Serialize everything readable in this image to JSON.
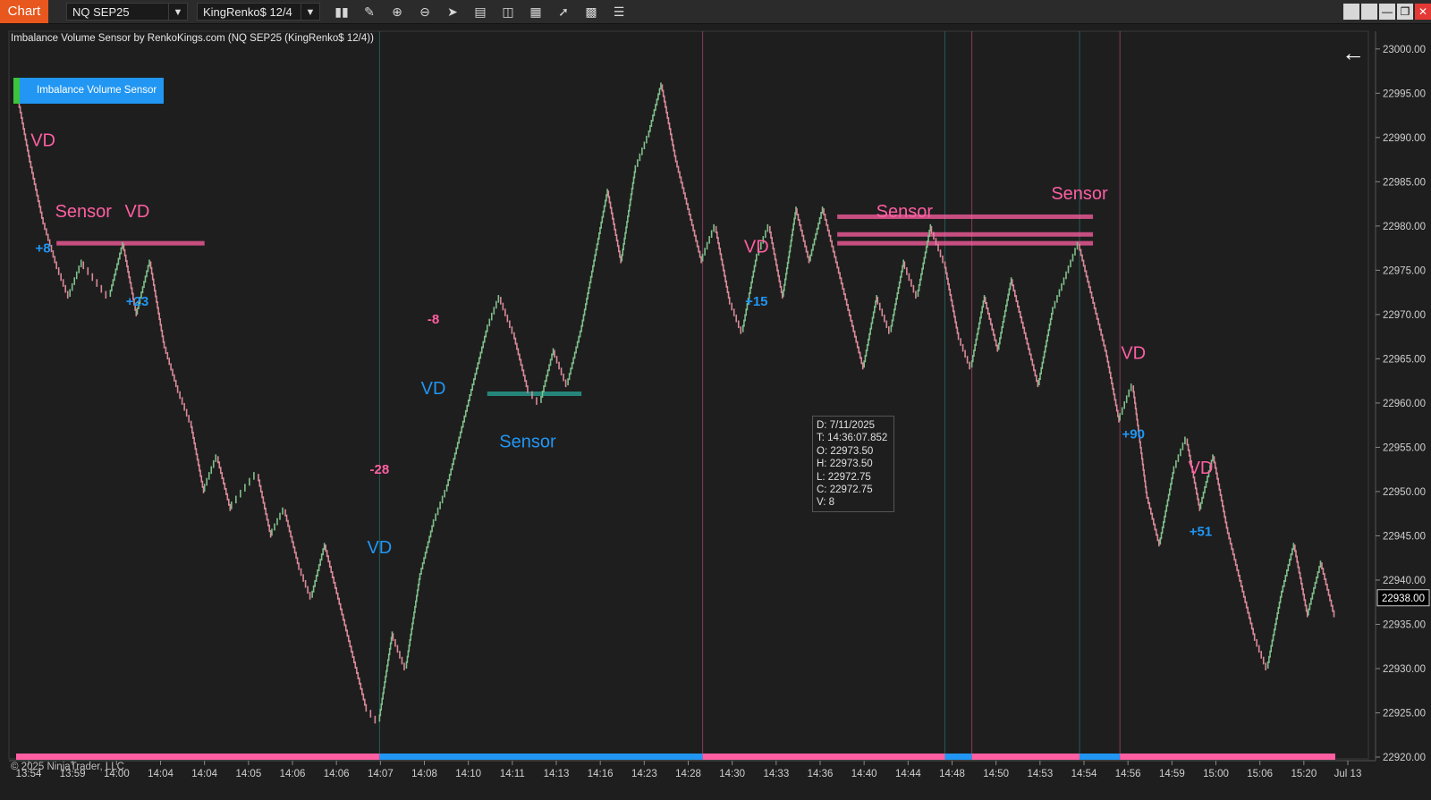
{
  "toolbar": {
    "chart_tab": "Chart",
    "instrument": "NQ SEP25",
    "bar_type": "KingRenko$ 12/4",
    "icons": [
      "bar-style-icon",
      "draw-tool-icon",
      "zoom-in-icon",
      "zoom-out-icon",
      "pointer-icon",
      "data-box-icon",
      "properties-icon",
      "indicators-icon",
      "strategies-icon",
      "chart-trader-icon",
      "object-list-icon"
    ],
    "window_buttons": [
      "tile-icon",
      "tile-icon",
      "minimize-icon",
      "maximize-icon",
      "close-icon"
    ]
  },
  "indicator_label": "Imbalance Volume Sensor by RenkoKings.com (NQ SEP25 (KingRenko$ 12/4))",
  "ivs_button": "Imbalance Volume Sensor",
  "copyright": "© 2025 NinjaTrader, LLC",
  "tooltip": {
    "d": "D: 7/11/2025",
    "t": "T:  14:36:07.852",
    "o": "O: 22973.50",
    "h": "H: 22973.50",
    "l": "L:  22972.75",
    "c": "C:  22972.75",
    "v": "V:  8"
  },
  "colors": {
    "bull": "#7fbf8a",
    "bear": "#d98a9a",
    "pink": "#ff5fa2",
    "blue": "#2196f3",
    "teal": "#2aa89a",
    "price_marker": "#000000"
  },
  "chart_data": {
    "type": "line",
    "ylim": [
      22920,
      23002
    ],
    "y_ticks": [
      "23000.00",
      "22995.00",
      "22990.00",
      "22985.00",
      "22980.00",
      "22975.00",
      "22970.00",
      "22965.00",
      "22960.00",
      "22955.00",
      "22950.00",
      "22945.00",
      "22940.00",
      "22935.00",
      "22930.00",
      "22925.00",
      "22920.00"
    ],
    "y_tick_values": [
      23000,
      22995,
      22990,
      22985,
      22980,
      22975,
      22970,
      22965,
      22960,
      22955,
      22950,
      22945,
      22940,
      22935,
      22930,
      22925,
      22920
    ],
    "x_ticks": [
      "13:54",
      "13:59",
      "14:00",
      "14:04",
      "14:04",
      "14:05",
      "14:06",
      "14:06",
      "14:07",
      "14:08",
      "14:10",
      "14:11",
      "14:13",
      "14:16",
      "14:23",
      "14:28",
      "14:30",
      "14:33",
      "14:36",
      "14:40",
      "14:44",
      "14:48",
      "14:50",
      "14:53",
      "14:54",
      "14:56",
      "14:59",
      "15:00",
      "15:06",
      "15:20",
      "Jul 13"
    ],
    "last_price": "22938.00",
    "last_price_value": 22938,
    "price_path": [
      [
        0,
        22996
      ],
      [
        1,
        22988
      ],
      [
        2,
        22981
      ],
      [
        3,
        22976
      ],
      [
        4,
        22972
      ],
      [
        5,
        22976
      ],
      [
        6,
        22974
      ],
      [
        7,
        22972
      ],
      [
        8,
        22978
      ],
      [
        9,
        22970
      ],
      [
        10,
        22976
      ],
      [
        11,
        22967
      ],
      [
        12,
        22962
      ],
      [
        13,
        22958
      ],
      [
        14,
        22950
      ],
      [
        15,
        22954
      ],
      [
        16,
        22948
      ],
      [
        17,
        22950
      ],
      [
        18,
        22952
      ],
      [
        19,
        22945
      ],
      [
        20,
        22948
      ],
      [
        21,
        22942
      ],
      [
        22,
        22938
      ],
      [
        23,
        22944
      ],
      [
        24,
        22938
      ],
      [
        25,
        22932
      ],
      [
        26,
        22926
      ],
      [
        27,
        22924
      ],
      [
        28,
        22934
      ],
      [
        29,
        22930
      ],
      [
        30,
        22940
      ],
      [
        31,
        22946
      ],
      [
        32,
        22950
      ],
      [
        33,
        22956
      ],
      [
        34,
        22962
      ],
      [
        35,
        22968
      ],
      [
        36,
        22972
      ],
      [
        37,
        22968
      ],
      [
        38,
        22962
      ],
      [
        39,
        22960
      ],
      [
        40,
        22966
      ],
      [
        41,
        22962
      ],
      [
        42,
        22968
      ],
      [
        43,
        22976
      ],
      [
        44,
        22984
      ],
      [
        45,
        22976
      ],
      [
        46,
        22986
      ],
      [
        47,
        22990
      ],
      [
        48,
        22996
      ],
      [
        49,
        22988
      ],
      [
        50,
        22982
      ],
      [
        51,
        22976
      ],
      [
        52,
        22980
      ],
      [
        53,
        22972
      ],
      [
        54,
        22968
      ],
      [
        55,
        22976
      ],
      [
        56,
        22980
      ],
      [
        57,
        22972
      ],
      [
        58,
        22982
      ],
      [
        59,
        22976
      ],
      [
        60,
        22982
      ],
      [
        61,
        22976
      ],
      [
        62,
        22970
      ],
      [
        63,
        22964
      ],
      [
        64,
        22972
      ],
      [
        65,
        22968
      ],
      [
        66,
        22976
      ],
      [
        67,
        22972
      ],
      [
        68,
        22980
      ],
      [
        69,
        22976
      ],
      [
        70,
        22968
      ],
      [
        71,
        22964
      ],
      [
        72,
        22972
      ],
      [
        73,
        22966
      ],
      [
        74,
        22974
      ],
      [
        75,
        22968
      ],
      [
        76,
        22962
      ],
      [
        77,
        22970
      ],
      [
        78,
        22974
      ],
      [
        79,
        22978
      ],
      [
        80,
        22972
      ],
      [
        81,
        22966
      ],
      [
        82,
        22958
      ],
      [
        83,
        22962
      ],
      [
        84,
        22950
      ],
      [
        85,
        22944
      ],
      [
        86,
        22952
      ],
      [
        87,
        22956
      ],
      [
        88,
        22948
      ],
      [
        89,
        22954
      ],
      [
        90,
        22946
      ],
      [
        91,
        22940
      ],
      [
        92,
        22934
      ],
      [
        93,
        22930
      ],
      [
        94,
        22938
      ],
      [
        95,
        22944
      ],
      [
        96,
        22936
      ],
      [
        97,
        22942
      ],
      [
        98,
        22936
      ]
    ],
    "annotations": [
      {
        "text": "VD",
        "color": "pink",
        "x": 2,
        "y": 22989
      },
      {
        "text": "Sensor",
        "color": "pink",
        "x": 5,
        "y": 22981
      },
      {
        "text": "VD",
        "color": "pink",
        "x": 9,
        "y": 22981
      },
      {
        "text": "+8",
        "color": "blue",
        "x": 2,
        "y": 22977
      },
      {
        "text": "+23",
        "color": "blue",
        "x": 9,
        "y": 22971
      },
      {
        "text": "-8",
        "color": "pink",
        "x": 31,
        "y": 22969
      },
      {
        "text": "VD",
        "color": "blue",
        "x": 31,
        "y": 22961
      },
      {
        "text": "-28",
        "color": "pink",
        "x": 27,
        "y": 22952
      },
      {
        "text": "VD",
        "color": "blue",
        "x": 27,
        "y": 22943
      },
      {
        "text": "Sensor",
        "color": "blue",
        "x": 38,
        "y": 22955
      },
      {
        "text": "VD",
        "color": "pink",
        "x": 55,
        "y": 22977
      },
      {
        "text": "+15",
        "color": "blue",
        "x": 55,
        "y": 22971
      },
      {
        "text": "Sensor",
        "color": "pink",
        "x": 66,
        "y": 22981
      },
      {
        "text": "Sensor",
        "color": "pink",
        "x": 79,
        "y": 22983
      },
      {
        "text": "VD",
        "color": "pink",
        "x": 83,
        "y": 22965
      },
      {
        "text": "+90",
        "color": "blue",
        "x": 83,
        "y": 22956
      },
      {
        "text": "VD",
        "color": "pink",
        "x": 88,
        "y": 22952
      },
      {
        "text": "+51",
        "color": "blue",
        "x": 88,
        "y": 22945
      }
    ],
    "zones": [
      {
        "x0": 3,
        "x1": 14,
        "y": 22978,
        "color": "pink"
      },
      {
        "x0": 35,
        "x1": 42,
        "y": 22961,
        "color": "teal"
      },
      {
        "x0": 61,
        "x1": 80,
        "y": 22981,
        "color": "pink"
      },
      {
        "x0": 61,
        "x1": 80,
        "y": 22979,
        "color": "pink"
      },
      {
        "x0": 61,
        "x1": 80,
        "y": 22978,
        "color": "pink"
      }
    ],
    "session_bar": [
      {
        "x0": 0,
        "x1": 27,
        "color": "pink"
      },
      {
        "x0": 27,
        "x1": 51,
        "color": "blue"
      },
      {
        "x0": 51,
        "x1": 69,
        "color": "pink"
      },
      {
        "x0": 69,
        "x1": 71,
        "color": "blue"
      },
      {
        "x0": 71,
        "x1": 79,
        "color": "pink"
      },
      {
        "x0": 79,
        "x1": 82,
        "color": "blue"
      },
      {
        "x0": 82,
        "x1": 98,
        "color": "pink"
      }
    ],
    "vertical_lines": [
      {
        "x": 27,
        "color": "teal"
      },
      {
        "x": 51,
        "color": "pink"
      },
      {
        "x": 69,
        "color": "teal"
      },
      {
        "x": 71,
        "color": "pink"
      },
      {
        "x": 79,
        "color": "teal"
      },
      {
        "x": 82,
        "color": "pink"
      }
    ]
  }
}
